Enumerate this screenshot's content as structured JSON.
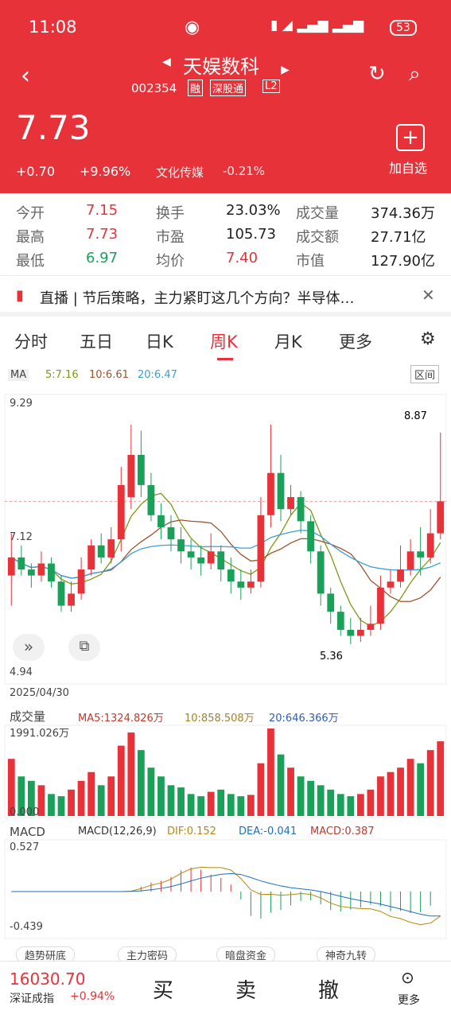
{
  "status": {
    "time": "11:08",
    "battery": "53"
  },
  "stock": {
    "name": "天娱数科",
    "code": "002354",
    "tags": [
      "融",
      "深股通",
      "L2"
    ],
    "price": "7.73",
    "change": "+0.70",
    "pct": "+9.96%",
    "sector": "文化传媒",
    "sector_pct": "-0.21%",
    "add_label": "加自选"
  },
  "stats": [
    {
      "label": "今开",
      "value": "7.15",
      "color": "red"
    },
    {
      "label": "换手",
      "value": "23.03%"
    },
    {
      "label": "成交量",
      "value": "374.36万"
    },
    {
      "label": "最高",
      "value": "7.73",
      "color": "red"
    },
    {
      "label": "市盈",
      "value": "105.73"
    },
    {
      "label": "成交额",
      "value": "27.71亿"
    },
    {
      "label": "最低",
      "value": "6.97",
      "color": "grn"
    },
    {
      "label": "均价",
      "value": "7.40",
      "color": "red"
    },
    {
      "label": "市值",
      "value": "127.90亿"
    }
  ],
  "news": {
    "text": "直播 | 节后策略，主力紧盯这几个方向？半导体…"
  },
  "tabs": [
    "分时",
    "五日",
    "日K",
    "周K",
    "月K",
    "更多"
  ],
  "ma": {
    "label": "MA",
    "ma5": "5:7.16",
    "ma10": "10:6.61",
    "ma20": "20:6.47",
    "range_btn": "区间"
  },
  "kchart": {
    "high_label": "9.29",
    "low_label": "4.94",
    "mid_label": "7.12",
    "peak": "8.87",
    "trough": "5.36",
    "date": "2025/04/30"
  },
  "volume": {
    "label": "成交量",
    "ma5": "MA5:1324.826万",
    "ma10": "10:858.508万",
    "ma20": "20:646.366万",
    "max": "1991.026万",
    "zero": "0.000"
  },
  "macd": {
    "label": "MACD",
    "params": "MACD(12,26,9)",
    "dif": "DIF:0.152",
    "dea": "DEA:-0.041",
    "macd": "MACD:0.387",
    "top": "0.527",
    "bottom": "-0.439"
  },
  "shortcuts": [
    "趋势研底",
    "主力密码",
    "暗盘资金",
    "神奇九转"
  ],
  "bottom": {
    "index_value": "16030.70",
    "index_name": "深证成指",
    "index_pct": "+0.94%",
    "buy": "买",
    "sell": "卖",
    "cancel": "撤",
    "more": "更多"
  },
  "chart_data": {
    "type": "candlestick",
    "ohlc": [
      [
        6.5,
        6.8,
        6.0,
        7.2
      ],
      [
        6.8,
        6.6,
        6.5,
        7.0
      ],
      [
        6.6,
        6.5,
        6.3,
        6.7
      ],
      [
        6.5,
        6.7,
        6.4,
        6.9
      ],
      [
        6.7,
        6.4,
        6.3,
        6.8
      ],
      [
        6.4,
        6.0,
        5.9,
        6.5
      ],
      [
        6.0,
        6.2,
        5.9,
        6.4
      ],
      [
        6.2,
        6.6,
        6.1,
        6.8
      ],
      [
        6.6,
        7.0,
        6.5,
        7.1
      ],
      [
        7.0,
        6.8,
        6.7,
        7.2
      ],
      [
        6.8,
        7.1,
        6.7,
        7.3
      ],
      [
        7.1,
        8.0,
        6.9,
        8.3
      ],
      [
        7.8,
        8.5,
        7.6,
        9.0
      ],
      [
        8.5,
        8.0,
        7.8,
        8.9
      ],
      [
        8.0,
        7.5,
        7.4,
        8.2
      ],
      [
        7.5,
        7.3,
        7.1,
        7.7
      ],
      [
        7.3,
        7.1,
        6.9,
        7.5
      ],
      [
        7.1,
        6.9,
        6.7,
        7.3
      ],
      [
        6.9,
        6.8,
        6.6,
        7.1
      ],
      [
        6.8,
        6.7,
        6.5,
        7.0
      ],
      [
        6.7,
        6.9,
        6.6,
        7.2
      ],
      [
        6.9,
        6.6,
        6.4,
        7.0
      ],
      [
        6.6,
        6.4,
        6.2,
        6.8
      ],
      [
        6.4,
        6.3,
        6.1,
        6.6
      ],
      [
        6.3,
        6.4,
        6.2,
        6.6
      ],
      [
        6.4,
        7.5,
        6.3,
        7.8
      ],
      [
        7.5,
        8.2,
        7.3,
        9.0
      ],
      [
        8.2,
        7.6,
        7.4,
        8.5
      ],
      [
        7.6,
        7.8,
        7.5,
        8.0
      ],
      [
        7.8,
        7.4,
        7.2,
        7.9
      ],
      [
        7.4,
        6.9,
        6.7,
        7.5
      ],
      [
        6.9,
        6.2,
        6.0,
        7.0
      ],
      [
        6.2,
        5.9,
        5.7,
        6.3
      ],
      [
        5.9,
        5.6,
        5.5,
        6.0
      ],
      [
        5.6,
        5.5,
        5.36,
        5.8
      ],
      [
        5.5,
        5.6,
        5.4,
        5.8
      ],
      [
        5.6,
        5.7,
        5.5,
        6.0
      ],
      [
        5.7,
        6.3,
        5.6,
        6.5
      ],
      [
        6.3,
        6.4,
        6.2,
        6.6
      ],
      [
        6.4,
        6.6,
        6.3,
        7.0
      ],
      [
        6.6,
        6.9,
        6.5,
        7.1
      ],
      [
        6.9,
        6.8,
        6.5,
        7.3
      ],
      [
        6.8,
        7.2,
        6.7,
        7.6
      ],
      [
        7.2,
        7.73,
        7.1,
        8.87
      ]
    ],
    "vol": [
      1300,
      900,
      800,
      700,
      500,
      450,
      600,
      800,
      1000,
      700,
      900,
      1600,
      1900,
      1500,
      1100,
      900,
      700,
      650,
      500,
      450,
      550,
      600,
      500,
      450,
      480,
      1200,
      1991,
      1400,
      1100,
      900,
      800,
      700,
      600,
      500,
      450,
      500,
      600,
      900,
      1000,
      1100,
      1300,
      1200,
      1500,
      1700
    ]
  }
}
